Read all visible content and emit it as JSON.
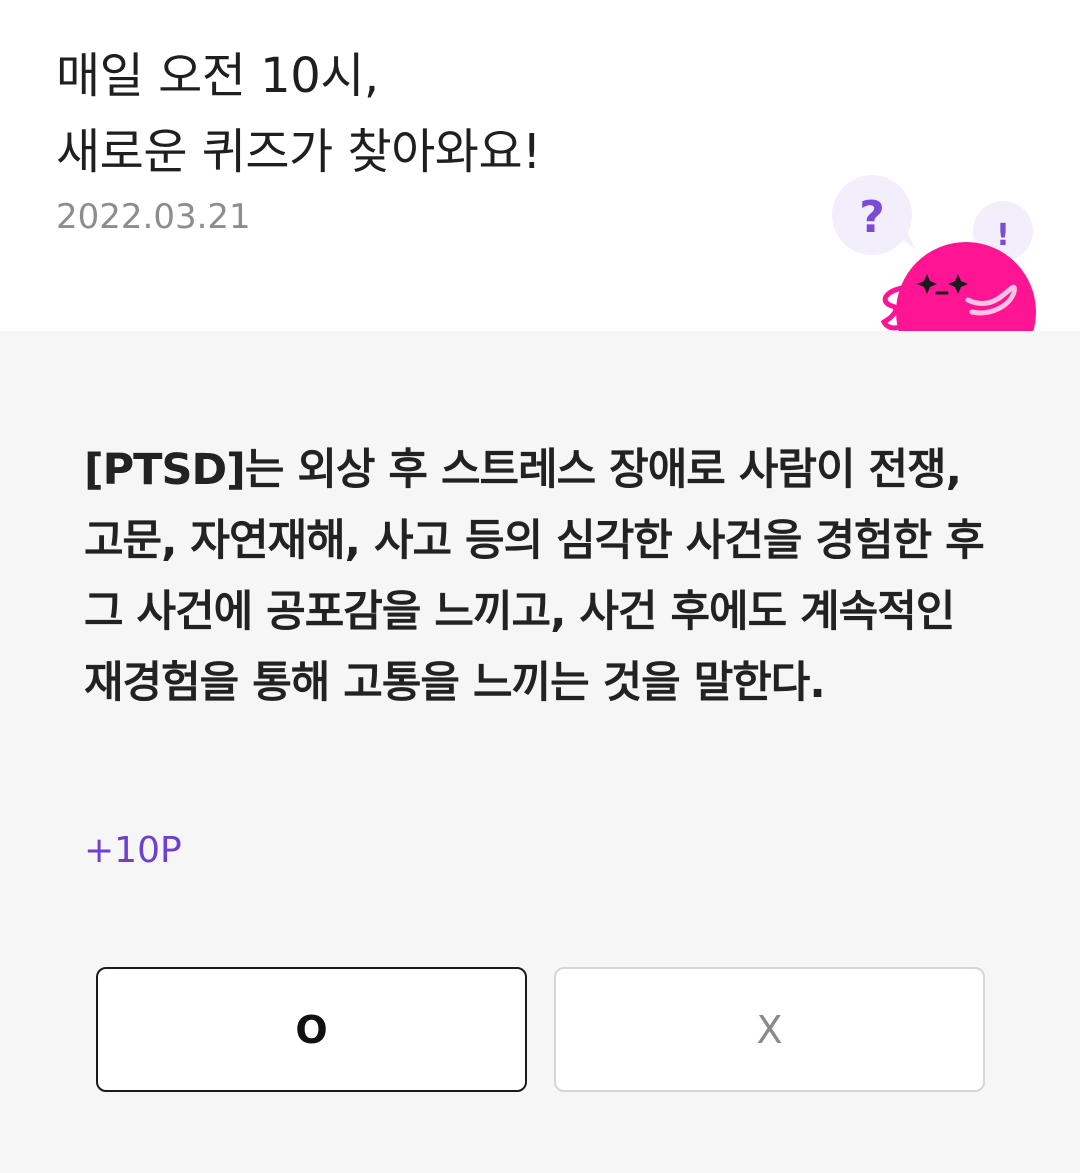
{
  "header": {
    "title_line1": "매일 오전 10시,",
    "title_line2": "새로운 퀴즈가 찾아와요!",
    "date": "2022.03.21"
  },
  "quiz": {
    "question": "[PTSD]는 외상 후 스트레스 장애로 사람이 전쟁, 고문, 자연재해, 사고 등의 심각한 사건을 경험한 후 그 사건에 공포감을 느끼고, 사건 후에도 계속적인 재경험을 통해 고통을 느끼는 것을 말한다.",
    "points": "+10P"
  },
  "answers": {
    "o_label": "O",
    "x_label": "X"
  },
  "mascot": {
    "question_bubble": "?",
    "exclaim_bubble": "!",
    "icon": "pink-blob-mascot-icon"
  },
  "colors": {
    "accent_purple": "#6f3fd2",
    "mascot_pink": "#ff1493",
    "bubble_bg": "#f2eefb"
  }
}
